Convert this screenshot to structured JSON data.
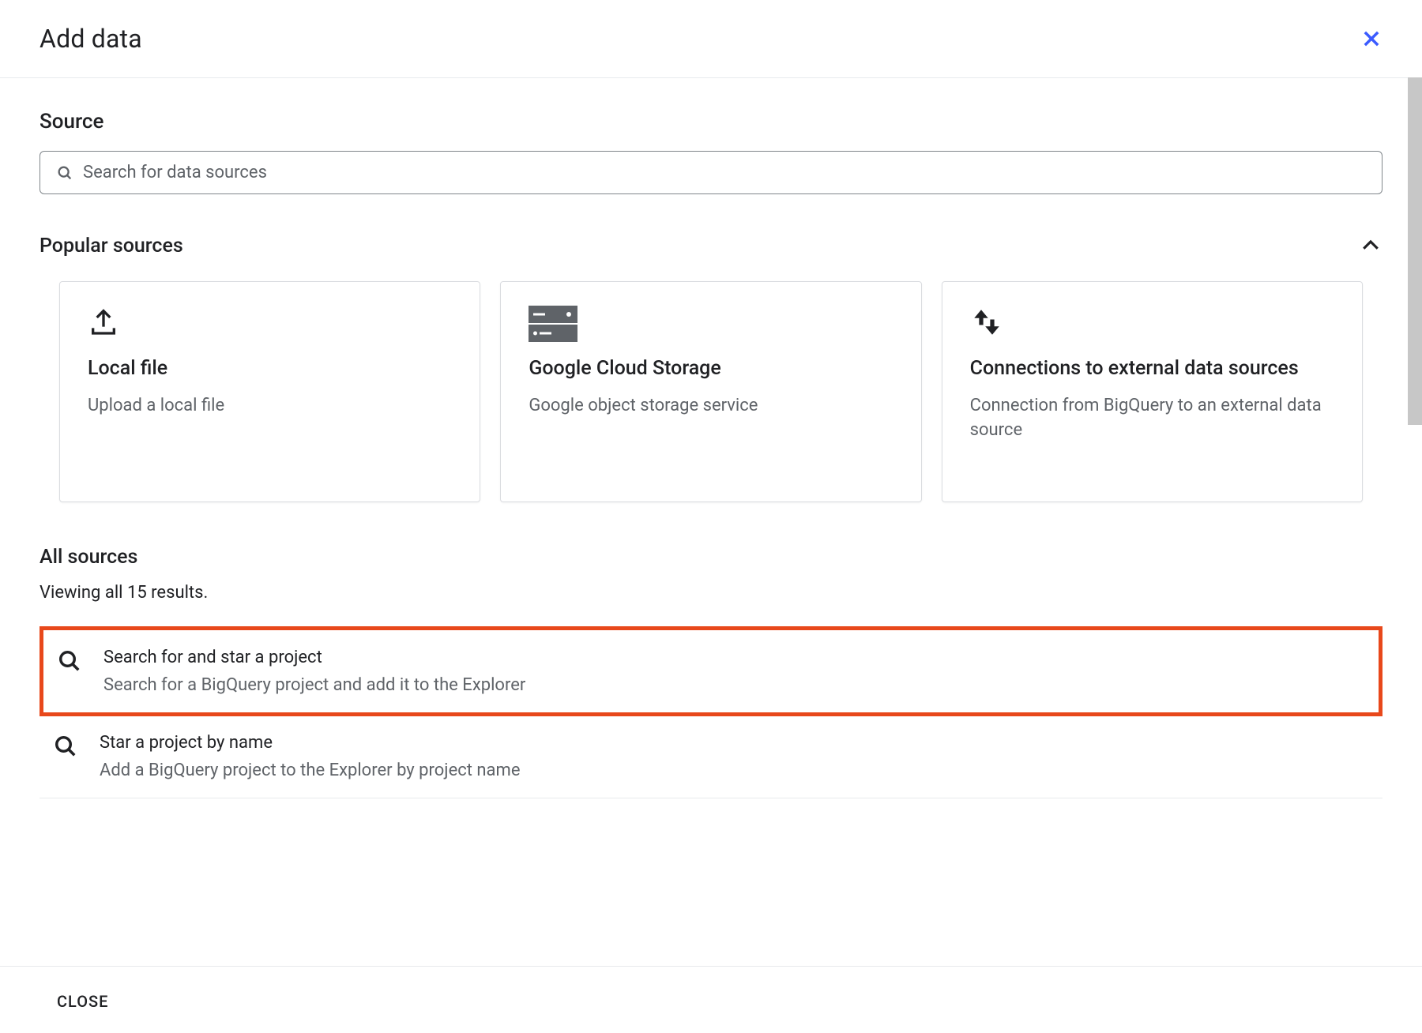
{
  "header": {
    "title": "Add data"
  },
  "source": {
    "label": "Source",
    "search_placeholder": "Search for data sources"
  },
  "popular": {
    "title": "Popular sources",
    "cards": [
      {
        "title": "Local file",
        "desc": "Upload a local file",
        "icon": "upload"
      },
      {
        "title": "Google Cloud Storage",
        "desc": "Google object storage service",
        "icon": "storage"
      },
      {
        "title": "Connections to external data sources",
        "desc": "Connection from BigQuery to an external data source",
        "icon": "swap"
      }
    ]
  },
  "all_sources": {
    "title": "All sources",
    "results_text": "Viewing all 15 results.",
    "items": [
      {
        "title": "Search for and star a project",
        "desc": "Search for a BigQuery project and add it to the Explorer",
        "icon": "search",
        "highlighted": true
      },
      {
        "title": "Star a project by name",
        "desc": "Add a BigQuery project to the Explorer by project name",
        "icon": "search",
        "highlighted": false
      }
    ]
  },
  "footer": {
    "close": "CLOSE"
  }
}
